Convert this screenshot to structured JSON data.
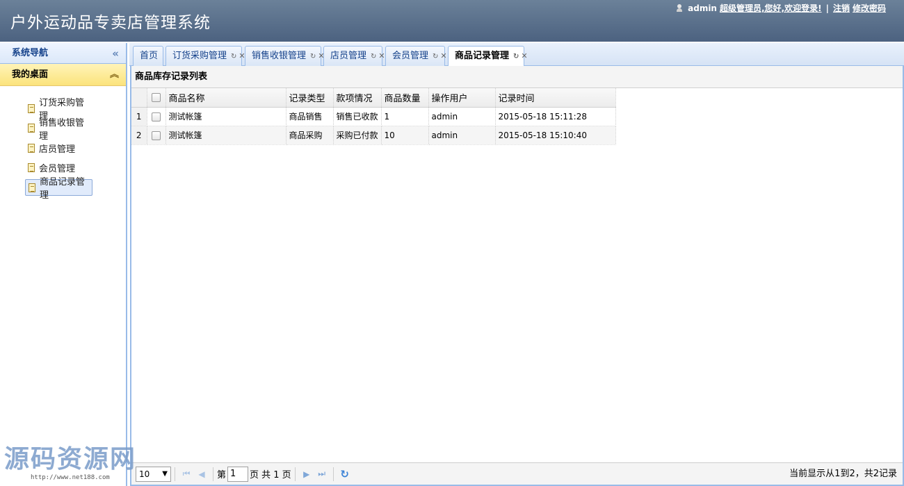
{
  "header": {
    "title": "户外运动品专卖店管理系统",
    "user": "admin",
    "greeting": "超级管理员,您好,欢迎登录!",
    "divider": "|",
    "logout": "注销",
    "change_password": "修改密码"
  },
  "sidebar": {
    "nav_title": "系统导航",
    "desk_title": "我的桌面",
    "items": [
      {
        "label": "订货采购管理"
      },
      {
        "label": "销售收银管理"
      },
      {
        "label": "店员管理"
      },
      {
        "label": "会员管理"
      },
      {
        "label": "商品记录管理"
      }
    ],
    "active_index": 4
  },
  "tabs": [
    {
      "label": "首页"
    },
    {
      "label": "订货采购管理"
    },
    {
      "label": "销售收银管理"
    },
    {
      "label": "店员管理"
    },
    {
      "label": "会员管理"
    },
    {
      "label": "商品记录管理"
    }
  ],
  "panel": {
    "title": "商品库存记录列表",
    "columns": [
      "商品名称",
      "记录类型",
      "款项情况",
      "商品数量",
      "操作用户",
      "记录时间"
    ],
    "rows": [
      {
        "num": "1",
        "name": "测试帐篷",
        "type": "商品销售",
        "payment": "销售已收款",
        "qty": "1",
        "user": "admin",
        "time": "2015-05-18 15:11:28"
      },
      {
        "num": "2",
        "name": "测试帐篷",
        "type": "商品采购",
        "payment": "采购已付款",
        "qty": "10",
        "user": "admin",
        "time": "2015-05-18 15:10:40"
      }
    ]
  },
  "pager": {
    "page_size": "10",
    "page_prefix": "第",
    "current_page": "1",
    "page_suffix": "页 共 1 页",
    "info": "当前显示从1到2，共2记录"
  },
  "watermark": {
    "text": "源码资源网",
    "url": "http://www.net188.com"
  }
}
